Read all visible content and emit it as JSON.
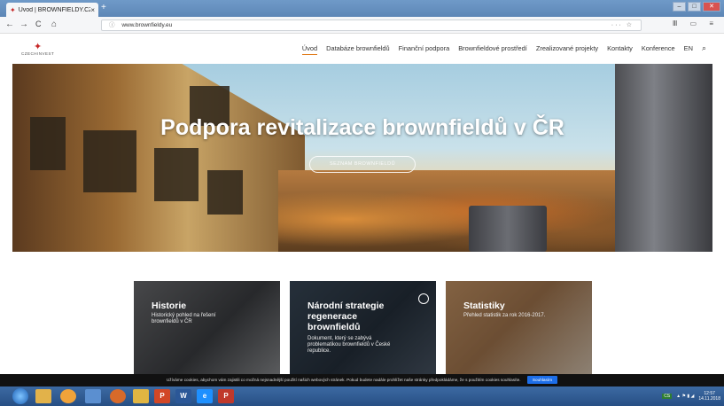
{
  "browser": {
    "tab_title": "Úvod | BROWNFIELDY.CZ",
    "tab_close": "×",
    "new_tab": "+",
    "url": "www.brownfieldy.eu",
    "url_actions": "··· ☆",
    "right_icons": "Ⅲ ▭ ≡",
    "nav": {
      "back": "←",
      "forward": "→",
      "reload": "C",
      "home": "⌂"
    },
    "window_controls": {
      "minimize": "–",
      "maximize": "□",
      "close": "✕"
    }
  },
  "site": {
    "logo": {
      "mark": "✦",
      "text": "CZECHINVEST"
    },
    "menu": [
      "Úvod",
      "Databáze brownfieldů",
      "Finanční podpora",
      "Brownfieldové prostředí",
      "Zrealizované projekty",
      "Kontakty",
      "Konference",
      "EN"
    ],
    "search_icon": "⌕"
  },
  "hero": {
    "title": "Podpora revitalizace brownfieldů v ČR",
    "button": "SEZNAM BROWNFIELDŮ"
  },
  "cards": [
    {
      "title": "Historie",
      "text": "Historický pohled na řešení brownfieldů v ČR"
    },
    {
      "title": "Národní strategie regenerace brownfieldů",
      "text": "Dokument, který se zabývá problematikou brownfieldů v České republice."
    },
    {
      "title": "Statistiky",
      "text": "Přehled statistik za rok 2016-2017."
    }
  ],
  "cookie": {
    "text": "Užíváme cookies, abychom vám zajistili co možná nejsnadnější použití našich webových stránek. Pokud budete nadále prohlížet naše stránky předpokládáme, že s použitím cookies souhlasíte.",
    "agree": "Souhlasím"
  },
  "taskbar": {
    "apps": [
      "",
      "",
      "",
      "",
      "",
      "P",
      "W",
      "e",
      "P"
    ],
    "tray": {
      "lang": "CS",
      "time": "12:57",
      "date": "14.11.2018"
    }
  }
}
